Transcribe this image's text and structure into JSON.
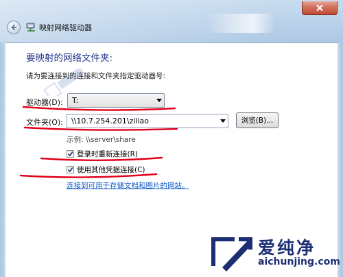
{
  "window": {
    "title": "映射网络驱动器"
  },
  "dialog": {
    "heading": "要映射的网络文件夹:",
    "description": "请为要连接到的连接和文件夹指定驱动器号:",
    "drive_label": "驱动器(D):",
    "drive_value": "T:",
    "folder_label": "文件夹(O):",
    "folder_value": "\\\\10.7.254.201\\ziliao",
    "browse_label": "浏览(B)...",
    "example_text": "示例: \\\\server\\share",
    "reconnect_label": "登录时重新连接(R)",
    "reconnect_checked": true,
    "credentials_label": "使用其他凭据连接(C)",
    "credentials_checked": true,
    "link_text": "连接到可用于存储文档和图片的网站。"
  },
  "watermark": {
    "site_cn": "爱纯净",
    "site_url": "aichunjing.com"
  },
  "colors": {
    "heading": "#1e3287",
    "link": "#0b55c4",
    "annotation": "#e0001a",
    "logo": "#1c2f73"
  },
  "icons": [
    "back-arrow-icon",
    "network-drive-icon",
    "close-icon",
    "dropdown-arrow-icon",
    "checkmark-icon"
  ]
}
